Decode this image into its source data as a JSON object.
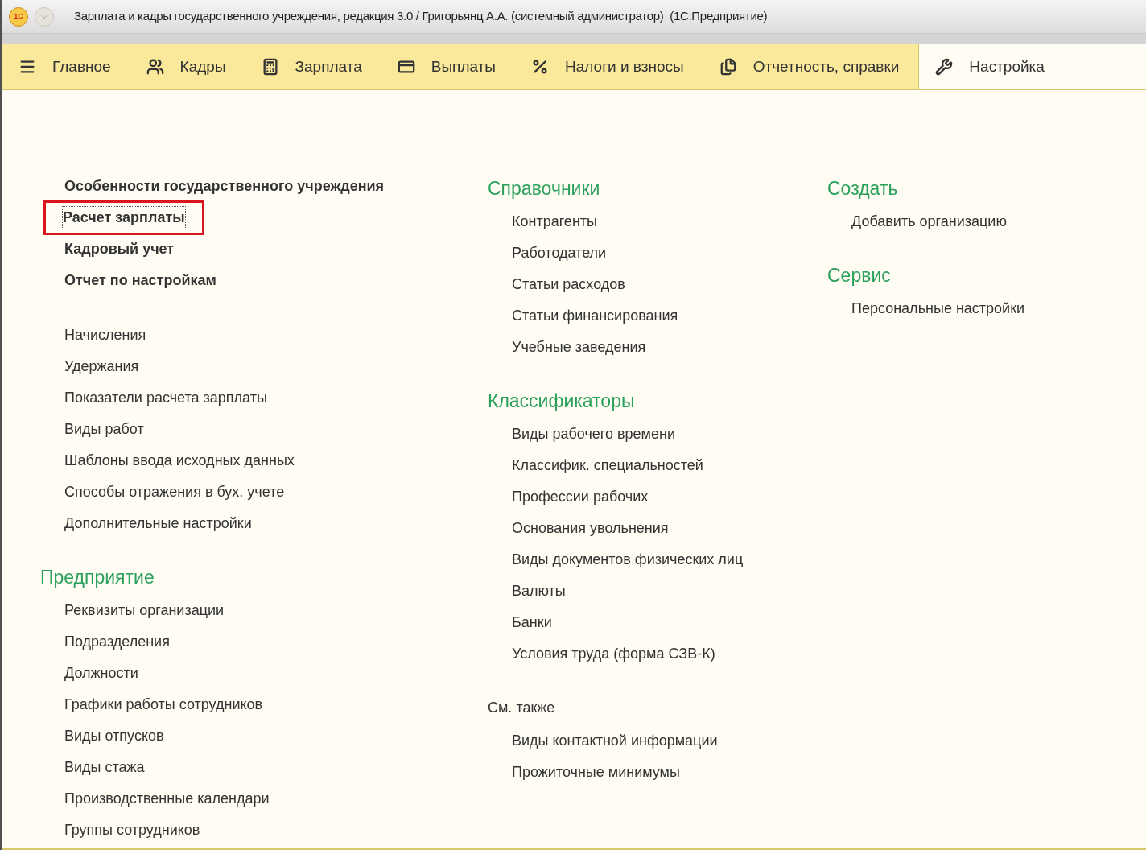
{
  "window": {
    "title": "Зарплата и кадры государственного учреждения, редакция 3.0 / Григорьянц А.А. (системный администратор)  (1С:Предприятие)",
    "logo": "1С"
  },
  "tabs": [
    {
      "label": "Главное",
      "selected": false
    },
    {
      "label": "Кадры",
      "selected": false
    },
    {
      "label": "Зарплата",
      "selected": false
    },
    {
      "label": "Выплаты",
      "selected": false
    },
    {
      "label": "Налоги и взносы",
      "selected": false
    },
    {
      "label": "Отчетность, справки",
      "selected": false
    },
    {
      "label": "Настройка",
      "selected": true
    }
  ],
  "columns": [
    {
      "groups": [
        {
          "items": [
            {
              "label": "Особенности государственного учреждения",
              "bold": true,
              "highlighted": false
            },
            {
              "label": "Расчет зарплаты",
              "bold": true,
              "highlighted": true
            },
            {
              "label": "Кадровый учет",
              "bold": true,
              "highlighted": false
            },
            {
              "label": "Отчет по настройкам",
              "bold": true,
              "highlighted": false
            }
          ]
        },
        {
          "items": [
            {
              "label": "Начисления",
              "bold": false,
              "highlighted": false
            },
            {
              "label": "Удержания",
              "bold": false,
              "highlighted": false
            },
            {
              "label": "Показатели расчета зарплаты",
              "bold": false,
              "highlighted": false
            },
            {
              "label": "Виды работ",
              "bold": false,
              "highlighted": false
            },
            {
              "label": "Шаблоны ввода исходных данных",
              "bold": false,
              "highlighted": false
            },
            {
              "label": "Способы отражения в бух. учете",
              "bold": false,
              "highlighted": false
            },
            {
              "label": "Дополнительные настройки",
              "bold": false,
              "highlighted": false
            }
          ]
        },
        {
          "title": "Предприятие",
          "kind": "section",
          "items": [
            {
              "label": "Реквизиты организации",
              "bold": false,
              "highlighted": false
            },
            {
              "label": "Подразделения",
              "bold": false,
              "highlighted": false
            },
            {
              "label": "Должности",
              "bold": false,
              "highlighted": false
            },
            {
              "label": "Графики работы сотрудников",
              "bold": false,
              "highlighted": false
            },
            {
              "label": "Виды отпусков",
              "bold": false,
              "highlighted": false
            },
            {
              "label": "Виды стажа",
              "bold": false,
              "highlighted": false
            },
            {
              "label": "Производственные календари",
              "bold": false,
              "highlighted": false
            },
            {
              "label": "Группы сотрудников",
              "bold": false,
              "highlighted": false
            }
          ]
        }
      ]
    },
    {
      "groups": [
        {
          "title": "Справочники",
          "kind": "section",
          "items": [
            {
              "label": "Контрагенты",
              "bold": false,
              "highlighted": false
            },
            {
              "label": "Работодатели",
              "bold": false,
              "highlighted": false
            },
            {
              "label": "Статьи расходов",
              "bold": false,
              "highlighted": false
            },
            {
              "label": "Статьи финансирования",
              "bold": false,
              "highlighted": false
            },
            {
              "label": "Учебные заведения",
              "bold": false,
              "highlighted": false
            }
          ]
        },
        {
          "title": "Классификаторы",
          "kind": "section",
          "items": [
            {
              "label": "Виды рабочего времени",
              "bold": false,
              "highlighted": false
            },
            {
              "label": "Классифик. специальностей",
              "bold": false,
              "highlighted": false
            },
            {
              "label": "Профессии рабочих",
              "bold": false,
              "highlighted": false
            },
            {
              "label": "Основания увольнения",
              "bold": false,
              "highlighted": false
            },
            {
              "label": "Виды документов физических лиц",
              "bold": false,
              "highlighted": false
            },
            {
              "label": "Валюты",
              "bold": false,
              "highlighted": false
            },
            {
              "label": "Банки",
              "bold": false,
              "highlighted": false
            },
            {
              "label": "Условия труда (форма СЗВ-К)",
              "bold": false,
              "highlighted": false
            }
          ]
        },
        {
          "title": "См. также",
          "kind": "see_also",
          "items": [
            {
              "label": "Виды контактной информации",
              "bold": false,
              "highlighted": false
            },
            {
              "label": "Прожиточные минимумы",
              "bold": false,
              "highlighted": false
            }
          ]
        }
      ]
    },
    {
      "groups": [
        {
          "title": "Создать",
          "kind": "section",
          "items": [
            {
              "label": "Добавить организацию",
              "bold": false,
              "highlighted": false
            }
          ]
        },
        {
          "title": "Сервис",
          "kind": "section",
          "items": [
            {
              "label": "Персональные настройки",
              "bold": false,
              "highlighted": false
            }
          ]
        }
      ]
    }
  ]
}
